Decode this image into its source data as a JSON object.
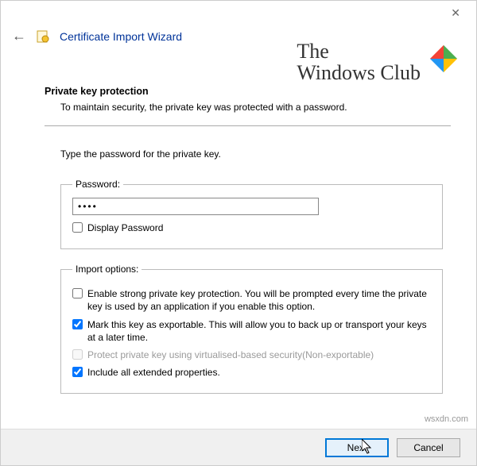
{
  "window": {
    "title": "Certificate Import Wizard"
  },
  "watermark": {
    "line1": "The",
    "line2": "Windows Club",
    "credit": "wsxdn.com"
  },
  "page": {
    "heading": "Private key protection",
    "subheading": "To maintain security, the private key was protected with a password.",
    "instruction": "Type the password for the private key."
  },
  "password": {
    "legend": "Password:",
    "value": "••••",
    "display_checked": false,
    "display_label": "Display Password"
  },
  "import_options": {
    "legend": "Import options:",
    "items": [
      {
        "checked": false,
        "disabled": false,
        "label": "Enable strong private key protection. You will be prompted every time the private key is used by an application if you enable this option."
      },
      {
        "checked": true,
        "disabled": false,
        "label": "Mark this key as exportable. This will allow you to back up or transport your keys at a later time."
      },
      {
        "checked": false,
        "disabled": true,
        "label": "Protect private key using virtualised-based security(Non-exportable)"
      },
      {
        "checked": true,
        "disabled": false,
        "label": "Include all extended properties."
      }
    ]
  },
  "buttons": {
    "next": "Next",
    "cancel": "Cancel"
  }
}
